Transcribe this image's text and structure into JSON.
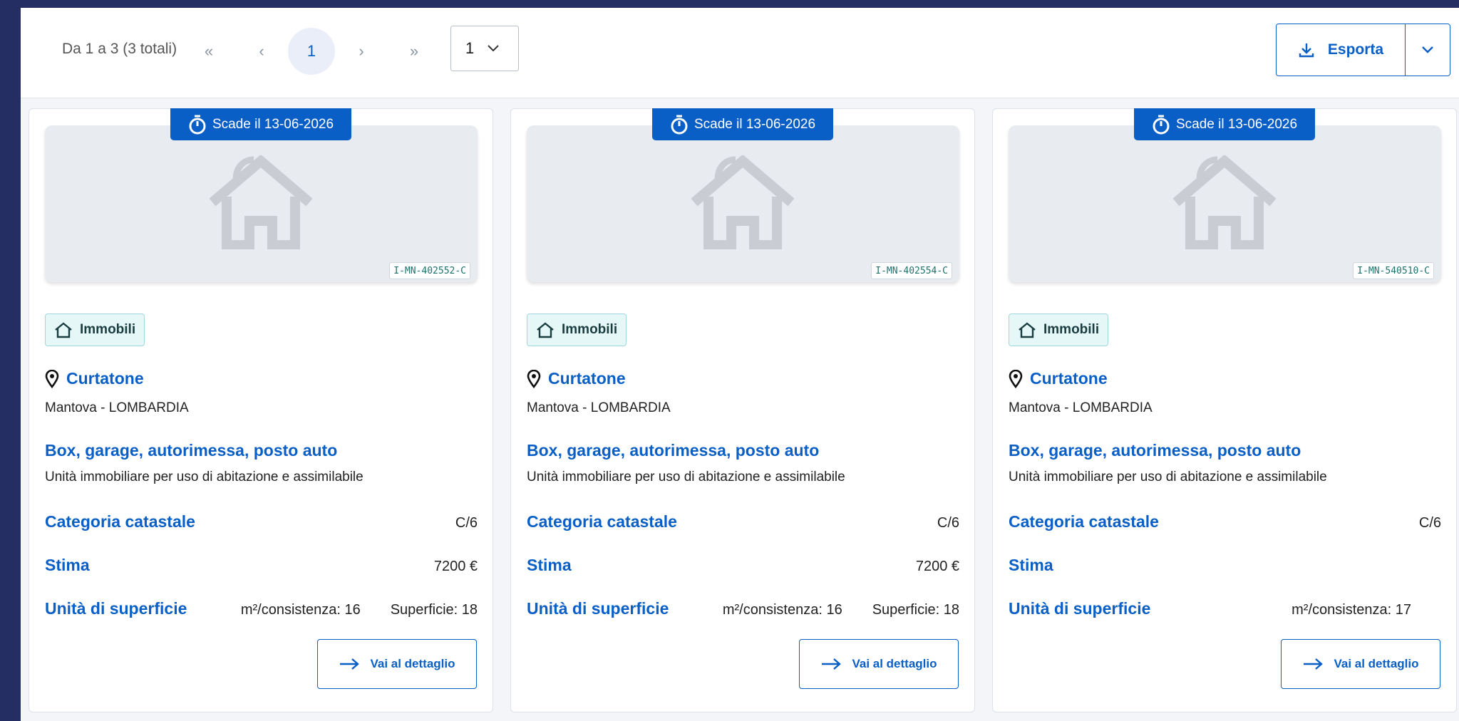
{
  "pagination": {
    "info": "Da 1 a 3 (3 totali)",
    "first": "«",
    "prev": "‹",
    "current": "1",
    "next": "›",
    "last": "»",
    "page_select_value": "1"
  },
  "export": {
    "label": "Esporta"
  },
  "colors": {
    "primary": "#0a5fc6",
    "frame": "#242e62",
    "badge_bg": "#e6f7f8"
  },
  "cards": [
    {
      "expiry": "Scade il 13-06-2026",
      "code": "I-MN-402552-C",
      "category": "Immobili",
      "city": "Curtatone",
      "province": "Mantova - LOMBARDIA",
      "typology": "Box, garage, autorimessa, posto auto",
      "subtype": "Unità  immobiliare per uso di abitazione e assimilabile",
      "cadastral_label": "Categoria catastale",
      "cadastral_value": "C/6",
      "estimate_label": "Stima",
      "estimate_value": "7200 €",
      "surface_label": "Unità di superficie",
      "consistency": "m²/consistenza: 16",
      "surface": "Superficie: 18",
      "detail_label": "Vai al dettaglio"
    },
    {
      "expiry": "Scade il 13-06-2026",
      "code": "I-MN-402554-C",
      "category": "Immobili",
      "city": "Curtatone",
      "province": "Mantova - LOMBARDIA",
      "typology": "Box, garage, autorimessa, posto auto",
      "subtype": "Unità  immobiliare per uso di abitazione e assimilabile",
      "cadastral_label": "Categoria catastale",
      "cadastral_value": "C/6",
      "estimate_label": "Stima",
      "estimate_value": "7200 €",
      "surface_label": "Unità di superficie",
      "consistency": "m²/consistenza: 16",
      "surface": "Superficie: 18",
      "detail_label": "Vai al dettaglio"
    },
    {
      "expiry": "Scade il 13-06-2026",
      "code": "I-MN-540510-C",
      "category": "Immobili",
      "city": "Curtatone",
      "province": "Mantova - LOMBARDIA",
      "typology": "Box, garage, autorimessa, posto auto",
      "subtype": "Unità  immobiliare per uso di abitazione e assimilabile",
      "cadastral_label": "Categoria catastale",
      "cadastral_value": "C/6",
      "estimate_label": "Stima",
      "estimate_value": "",
      "surface_label": "Unità di superficie",
      "consistency": "m²/consistenza: 17",
      "surface": "",
      "detail_label": "Vai al dettaglio"
    }
  ]
}
